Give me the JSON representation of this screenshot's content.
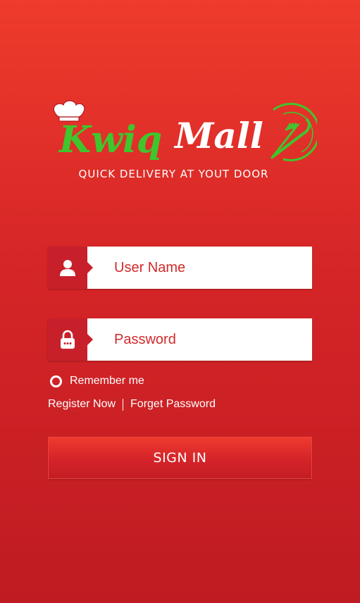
{
  "brand": {
    "name_part1": "Kwiq",
    "name_part2": "Mall",
    "tagline": "QUICK DELIVERY AT YOUT DOOR",
    "colors": {
      "green": "#3fc62d",
      "white": "#ffffff"
    }
  },
  "form": {
    "username": {
      "placeholder": "User Name",
      "value": "",
      "icon": "user-icon"
    },
    "password": {
      "placeholder": "Password",
      "value": "",
      "icon": "lock-icon"
    },
    "remember_label": "Remember me",
    "register_label": "Register Now",
    "forget_label": "Forget Password",
    "signin_label": "SIGN IN"
  },
  "theme": {
    "background_top": "#ee3b2c",
    "background_bottom": "#bf1b22",
    "icon_box": "#c8202a",
    "placeholder": "#d02a2a"
  }
}
